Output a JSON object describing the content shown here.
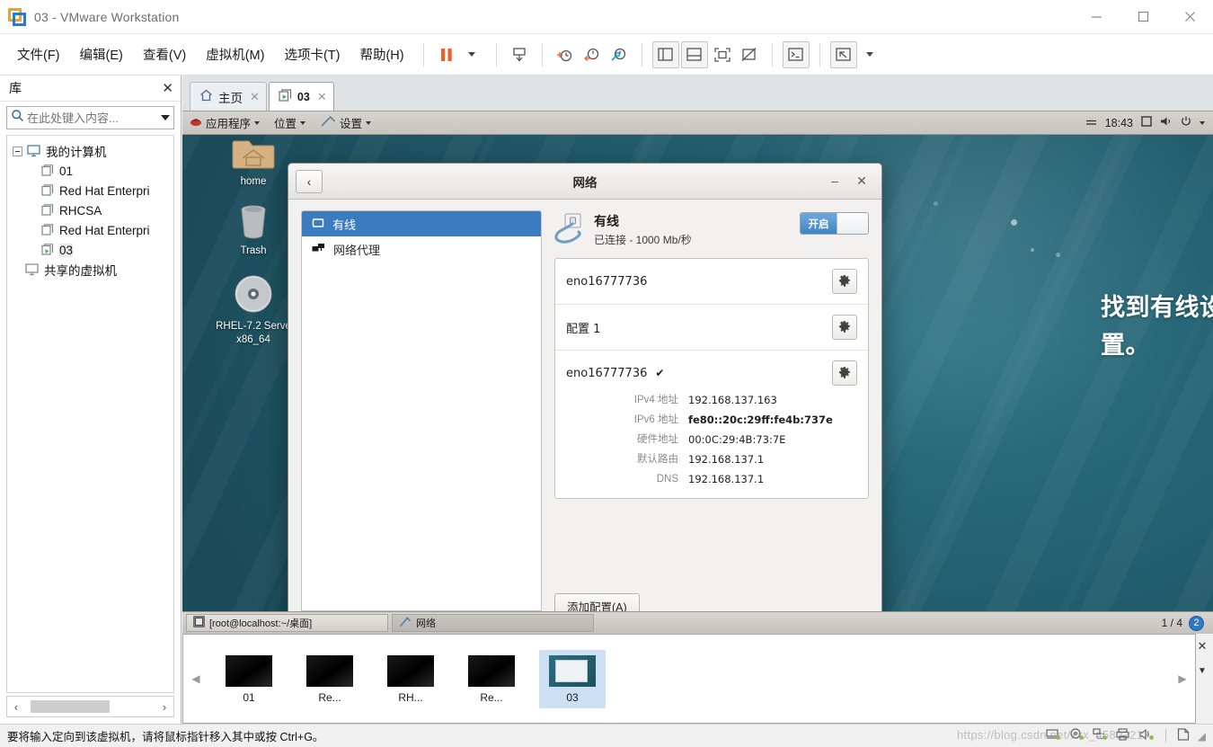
{
  "window": {
    "title": "03 - VMware Workstation",
    "app_icon": "vmware-logo-icon",
    "minimize": "–",
    "maximize": "□",
    "close": "✕"
  },
  "menubar": {
    "items": [
      {
        "label": "文件(F)",
        "name": "menu-file"
      },
      {
        "label": "编辑(E)",
        "name": "menu-edit"
      },
      {
        "label": "查看(V)",
        "name": "menu-view"
      },
      {
        "label": "虚拟机(M)",
        "name": "menu-vm"
      },
      {
        "label": "选项卡(T)",
        "name": "menu-tabs"
      },
      {
        "label": "帮助(H)",
        "name": "menu-help"
      }
    ]
  },
  "library": {
    "title": "库",
    "close_label": "✕",
    "search_placeholder": "在此处键入内容...",
    "search_value": "",
    "tree": [
      {
        "label": "我的计算机",
        "icon": "computer-icon",
        "level": 0,
        "expander": true
      },
      {
        "label": "01",
        "icon": "vm-icon",
        "level": 1,
        "expander": false
      },
      {
        "label": "Red Hat Enterpri",
        "icon": "vm-icon",
        "level": 1,
        "expander": false
      },
      {
        "label": "RHCSA",
        "icon": "vm-icon",
        "level": 1,
        "expander": false
      },
      {
        "label": "Red Hat Enterpri",
        "icon": "vm-icon",
        "level": 1,
        "expander": false
      },
      {
        "label": "03",
        "icon": "vm-running-icon",
        "level": 1,
        "expander": false,
        "selected": true
      },
      {
        "label": "共享的虚拟机",
        "icon": "shared-vm-icon",
        "level": 0,
        "expander": false
      }
    ],
    "scroll_left": "‹",
    "scroll_right": "›"
  },
  "tabs": [
    {
      "label": "主页",
      "icon": "home-icon",
      "active": false,
      "close": "✕"
    },
    {
      "label": "03",
      "icon": "vm-running-icon",
      "active": true,
      "close": "✕"
    }
  ],
  "gnome_panel": {
    "applications": "应用程序",
    "places": "位置",
    "settings": "设置",
    "clock": "18:43",
    "indicators": [
      "window-icon",
      "volume-icon",
      "power-icon",
      "chevron-down-icon"
    ]
  },
  "desktop_icons": [
    {
      "label": "home",
      "icon": "home-folder-icon"
    },
    {
      "label": "Trash",
      "icon": "trash-icon"
    },
    {
      "label": "RHEL-7.2 Serve x86_64",
      "icon": "cd-icon"
    }
  ],
  "annotation": {
    "text": "找到有线设置，点击添加配置。"
  },
  "dialog": {
    "title": "网络",
    "back_icon": "chevron-left-icon",
    "minimize": "–",
    "close": "✕",
    "sidebar": [
      {
        "label": "有线",
        "icon": "wired-icon",
        "selected": true
      },
      {
        "label": "网络代理",
        "icon": "proxy-icon",
        "selected": false
      }
    ],
    "list_add": "+",
    "list_remove": "−",
    "wired": {
      "name": "有线",
      "status": "已连接 - 1000 Mb/秒",
      "toggle_label": "开启",
      "toggle_on": true
    },
    "connections": [
      {
        "name": "eno16777736",
        "checked": false,
        "gear": "gear-icon",
        "details": []
      },
      {
        "name": "配置 1",
        "checked": false,
        "gear": "gear-icon",
        "details": []
      },
      {
        "name": "eno16777736",
        "checked": true,
        "check_mark": "✔",
        "gear": "gear-icon",
        "details": [
          {
            "label": "IPv4 地址",
            "value": "192.168.137.163"
          },
          {
            "label": "IPv6 地址",
            "value": "fe80::20c:29ff:fe4b:737e"
          },
          {
            "label": "硬件地址",
            "value": "00:0C:29:4B:73:7E"
          },
          {
            "label": "默认路由",
            "value": "192.168.137.1"
          },
          {
            "label": "DNS",
            "value": "192.168.137.1"
          }
        ]
      }
    ],
    "add_config_button": "添加配置(A)"
  },
  "vm_taskbar": {
    "tasks": [
      {
        "label": "[root@localhost:~/桌面]",
        "icon": "terminal-icon",
        "selected": false
      },
      {
        "label": "网络",
        "icon": "network-tool-icon",
        "selected": true
      }
    ],
    "workspace": "1 / 4",
    "workspace_badge": "2"
  },
  "thumbnails": {
    "prev_arrow": "◀",
    "next_arrow": "▶",
    "items": [
      {
        "label": "01",
        "selected": false,
        "live": false
      },
      {
        "label": "Re...",
        "selected": false,
        "live": false
      },
      {
        "label": "RH...",
        "selected": false,
        "live": false
      },
      {
        "label": "Re...",
        "selected": false,
        "live": false
      },
      {
        "label": "03",
        "selected": true,
        "live": true
      }
    ],
    "close": "✕",
    "chevron": "▼"
  },
  "statusbar": {
    "message": "要将输入定向到该虚拟机，请将鼠标指针移入其中或按 Ctrl+G。",
    "watermark": "https://blog.csdn.net/xxx_45802217",
    "grip": "◢"
  },
  "colors": {
    "accent_blue": "#3b7bc0",
    "toggle_on": "#3d86c6",
    "vmware_orange": "#e8a33d",
    "desktop_teal": "#2e7384",
    "selection": "#cddff2"
  }
}
